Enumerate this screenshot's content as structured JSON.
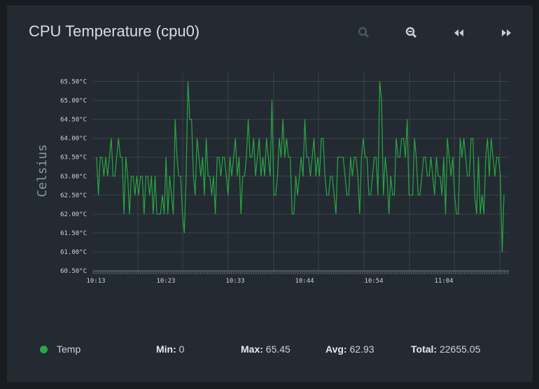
{
  "panel": {
    "title": "CPU Temperature (cpu0)"
  },
  "toolbar": {
    "zoom_in_icon": "magnifier-plus-icon",
    "zoom_out_icon": "magnifier-minus-icon",
    "back_icon": "double-left-arrow-icon",
    "forward_icon": "double-right-arrow-icon"
  },
  "colors": {
    "series": "#28a745",
    "grid": "#39434c",
    "text": "#cfd3d7",
    "panel": "#232a31"
  },
  "chart_data": {
    "type": "line",
    "title": "",
    "xlabel": "",
    "ylabel": "Celsius",
    "ylim": [
      60.5,
      65.75
    ],
    "yticks": [
      "60.50°C",
      "61.00°C",
      "61.50°C",
      "62.00°C",
      "62.50°C",
      "63.00°C",
      "63.50°C",
      "64.00°C",
      "64.50°C",
      "65.00°C",
      "65.50°C"
    ],
    "xticks": [
      "10:13",
      "10:23",
      "10:33",
      "10:44",
      "10:54",
      "11:04"
    ],
    "grid": true,
    "series": [
      {
        "name": "Temp",
        "values": [
          63.5,
          62.5,
          63.5,
          63.5,
          63,
          63.5,
          63,
          63.5,
          64,
          63,
          63,
          63.5,
          64,
          63.5,
          63.5,
          62,
          63.5,
          63,
          62,
          63,
          63,
          62.5,
          63,
          62.5,
          63,
          63,
          62,
          63,
          63,
          62.5,
          63,
          62,
          63,
          62,
          62,
          62,
          62.5,
          62,
          63.5,
          62,
          63,
          62.5,
          62,
          64.5,
          63.5,
          63,
          63,
          62,
          61.5,
          63,
          65.5,
          64.5,
          64.5,
          63,
          62.5,
          64,
          63.5,
          63,
          63.5,
          62.5,
          64,
          63,
          63,
          62.5,
          63,
          62,
          63.5,
          63.5,
          63,
          63.5,
          63.5,
          63,
          62.5,
          63.5,
          63,
          63.5,
          64,
          63,
          63.5,
          62,
          63,
          63,
          63.5,
          64.5,
          63.5,
          63.5,
          64,
          63,
          63.5,
          64,
          63,
          63.5,
          63,
          64,
          63.5,
          63,
          65,
          62.5,
          62.5,
          63,
          64,
          63.5,
          64.5,
          63.5,
          64,
          63.5,
          63.5,
          62,
          62,
          63,
          62.5,
          63,
          63.5,
          63,
          64.5,
          63.5,
          63.5,
          63,
          63.5,
          64,
          63,
          63.5,
          63,
          64,
          64,
          63,
          62.5,
          62.5,
          63,
          63,
          62.5,
          62,
          63.5,
          63.5,
          63.5,
          63.5,
          63,
          62.5,
          62.5,
          63.5,
          63,
          63.5,
          63.5,
          63,
          62,
          63.5,
          64,
          63.5,
          63.5,
          62.5,
          62.5,
          63,
          63.5,
          63.5,
          62.5,
          65.5,
          65,
          62.5,
          63.5,
          63,
          62,
          63,
          62.5,
          62.5,
          64,
          63.5,
          63.5,
          64,
          64,
          63.5,
          64.5,
          62.5,
          62.5,
          62.5,
          64,
          63.5,
          62.5,
          62.5,
          63,
          63.5,
          63.5,
          63,
          63,
          63.5,
          63,
          62.5,
          63.5,
          63,
          63,
          62.5,
          63.5,
          62,
          64,
          63.5,
          63,
          63.5,
          62.5,
          62,
          62,
          64,
          63.5,
          64,
          63.5,
          63,
          63,
          64,
          64,
          62.5,
          62,
          63.5,
          62,
          62.5,
          62,
          63.5,
          64,
          63,
          64,
          63.5,
          63,
          63.5,
          63.5,
          63,
          61,
          62.5
        ]
      }
    ],
    "legend": {
      "placement": "bottom",
      "stats": {
        "min": "0",
        "max": "65.45",
        "avg": "62.93",
        "total": "22655.05"
      }
    }
  },
  "legend": {
    "series_name": "Temp",
    "min_label": "Min:",
    "min_value": "0",
    "max_label": "Max:",
    "max_value": "65.45",
    "avg_label": "Avg:",
    "avg_value": "62.93",
    "total_label": "Total:",
    "total_value": "22655.05"
  }
}
